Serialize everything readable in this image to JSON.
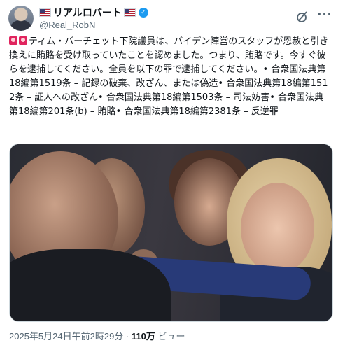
{
  "author": {
    "display_name": "リアルロバート",
    "handle": "@Real_RobN",
    "verified": true,
    "avatar_icon": "profile-photo"
  },
  "header_actions": {
    "grok_icon": "grok-icon",
    "more_icon": "more-options-icon"
  },
  "post": {
    "text": "ティム・バーチェット下院議員は、バイデン陣営のスタッフが恩赦と引き換えに賄賂を受け取っていたことを認めました。つまり、賄賂です。今すぐ彼らを逮捕してください。全員を以下の罪で逮捕してください。• 合衆国法典第18編第1519条 – 記録の破棄、改ざん、または偽造• 合衆国法典第18編第1512条 – 証人への改ざん• 合衆国法典第18編第1503条 – 司法妨害• 合衆国法典第18編第201条(b) – 賄賂• 合衆国法典第18編第2381条 – 反逆罪",
    "prefix_icons": [
      "siren-icon",
      "siren-icon"
    ]
  },
  "media": {
    "type": "photo"
  },
  "meta": {
    "timestamp": "2025年5月24日午前2時29分",
    "separator": " · ",
    "views_count": "110万",
    "views_label": " ビュー"
  },
  "colors": {
    "text": "#0f1419",
    "secondary": "#536471",
    "verified": "#1d9bf0",
    "siren": "#e0245e"
  }
}
